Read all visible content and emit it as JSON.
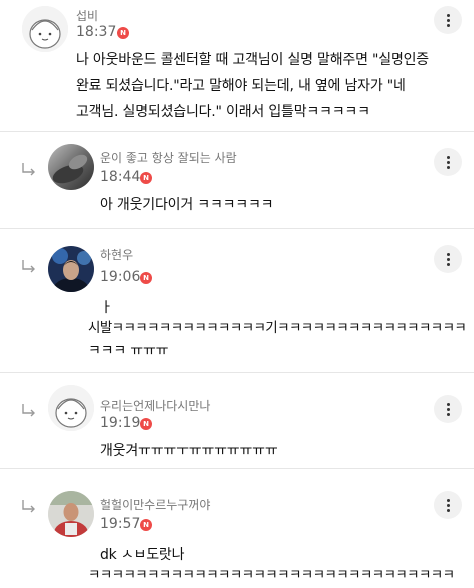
{
  "comments": [
    {
      "name": "섭비",
      "time": "18:37",
      "badge": "N",
      "lines": [
        "나 아웃바운드 콜센터할 때 고객님이 실명 말해주면 \"실명인증",
        "완료 되셨습니다.\"라고 말해야 되는데, 내 옆에 남자가 \"네",
        "고객님. 실명되셨습니다.\" 이래서 입틀막ㅋㅋㅋㅋㅋ"
      ]
    },
    {
      "name": "운이 좋고 항상 잘되는 사람",
      "time": "18:44",
      "badge": "N",
      "lines": [
        "아 개웃기다이거 ㅋㅋㅋㅋㅋㅋ"
      ]
    },
    {
      "name": "하현우",
      "time": "19:06",
      "badge": "N",
      "lines": [
        "ㅏ",
        "시발ㅋㅋㅋㅋㅋㅋㅋㅋㅋㅋㅋㅋㅋ기ㅋㅋㅋㅋㅋㅋㅋㅋㅋㅋㅋㅋㅋㅋㅋㅋ",
        "ㅋㅋㅋ ㅠㅠㅠ"
      ]
    },
    {
      "name": "우리는언제나다시만나",
      "time": "19:19",
      "badge": "N",
      "lines": [
        "개웃겨ㅠㅠㅠㅜㅠㅠㅠㅠㅠㅠㅠ"
      ]
    },
    {
      "name": "헐헐이만수르누구꺼야",
      "time": "19:57",
      "badge": "N",
      "lines": [
        "dk ㅅㅂ도랏나",
        "ㅋㅋㅋㅋㅋㅋㅋㅋㅋㅋㅋㅋㅋㅋㅋㅋㅋㅋㅋㅋㅋㅋㅋㅋㅋㅋㅋㅋㅋㅋㅋ"
      ]
    }
  ]
}
